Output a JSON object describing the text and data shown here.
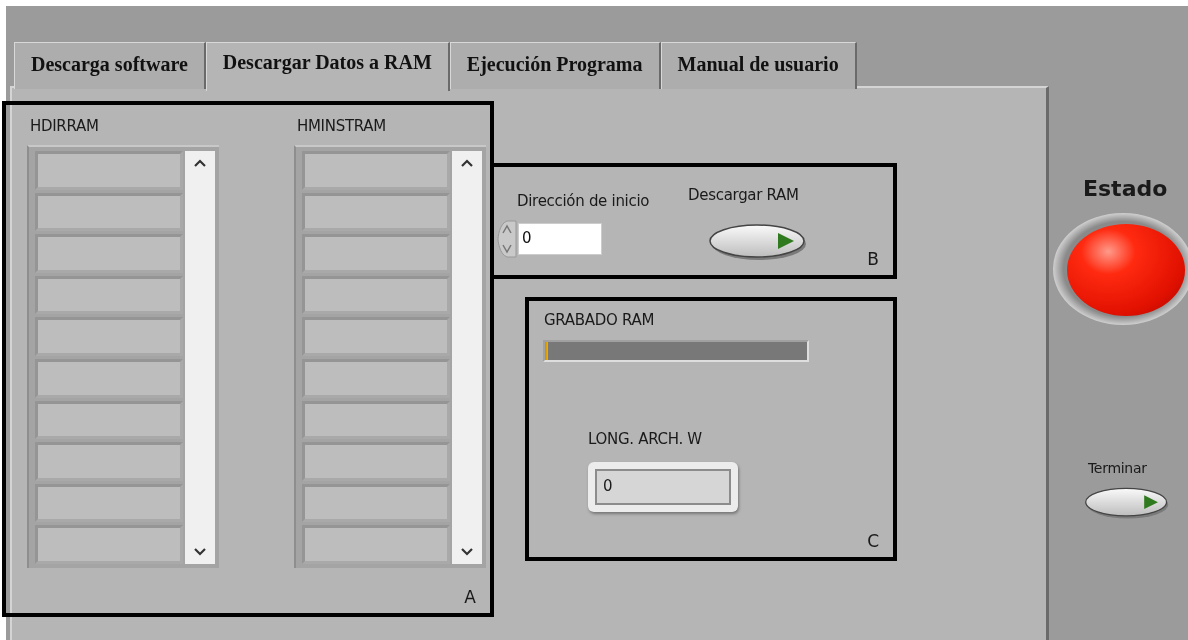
{
  "tabs": [
    {
      "label": "Descarga software",
      "selected": false
    },
    {
      "label": "Descargar Datos a RAM",
      "selected": true
    },
    {
      "label": "Ejecución Programa",
      "selected": false
    },
    {
      "label": "Manual de usuario",
      "selected": false
    }
  ],
  "arrays": [
    {
      "label": "HDIRRAM"
    },
    {
      "label": "HMINSTRAM"
    }
  ],
  "start_address": {
    "label": "Dirección de inicio",
    "value": "0"
  },
  "download_button": {
    "label": "Descargar RAM"
  },
  "progress": {
    "label": "GRABADO RAM",
    "level": 0.01
  },
  "file_length": {
    "label": "LONG. ARCH. W",
    "value": "0"
  },
  "frames": [
    {
      "letter": "A"
    },
    {
      "letter": "B"
    },
    {
      "letter": "C"
    }
  ],
  "status": {
    "label": "Estado",
    "on": true
  },
  "stop_button": {
    "label": "Terminar"
  }
}
